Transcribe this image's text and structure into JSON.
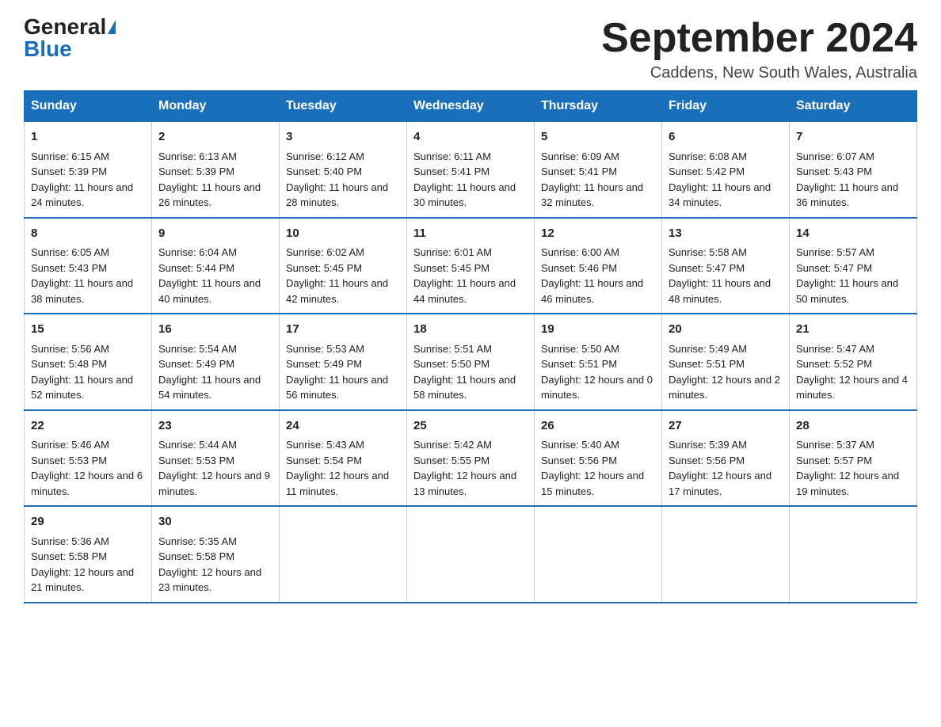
{
  "header": {
    "logo_general": "General",
    "logo_blue": "Blue",
    "month_title": "September 2024",
    "location": "Caddens, New South Wales, Australia"
  },
  "weekdays": [
    "Sunday",
    "Monday",
    "Tuesday",
    "Wednesday",
    "Thursday",
    "Friday",
    "Saturday"
  ],
  "weeks": [
    [
      {
        "day": "1",
        "sunrise": "6:15 AM",
        "sunset": "5:39 PM",
        "daylight": "11 hours and 24 minutes."
      },
      {
        "day": "2",
        "sunrise": "6:13 AM",
        "sunset": "5:39 PM",
        "daylight": "11 hours and 26 minutes."
      },
      {
        "day": "3",
        "sunrise": "6:12 AM",
        "sunset": "5:40 PM",
        "daylight": "11 hours and 28 minutes."
      },
      {
        "day": "4",
        "sunrise": "6:11 AM",
        "sunset": "5:41 PM",
        "daylight": "11 hours and 30 minutes."
      },
      {
        "day": "5",
        "sunrise": "6:09 AM",
        "sunset": "5:41 PM",
        "daylight": "11 hours and 32 minutes."
      },
      {
        "day": "6",
        "sunrise": "6:08 AM",
        "sunset": "5:42 PM",
        "daylight": "11 hours and 34 minutes."
      },
      {
        "day": "7",
        "sunrise": "6:07 AM",
        "sunset": "5:43 PM",
        "daylight": "11 hours and 36 minutes."
      }
    ],
    [
      {
        "day": "8",
        "sunrise": "6:05 AM",
        "sunset": "5:43 PM",
        "daylight": "11 hours and 38 minutes."
      },
      {
        "day": "9",
        "sunrise": "6:04 AM",
        "sunset": "5:44 PM",
        "daylight": "11 hours and 40 minutes."
      },
      {
        "day": "10",
        "sunrise": "6:02 AM",
        "sunset": "5:45 PM",
        "daylight": "11 hours and 42 minutes."
      },
      {
        "day": "11",
        "sunrise": "6:01 AM",
        "sunset": "5:45 PM",
        "daylight": "11 hours and 44 minutes."
      },
      {
        "day": "12",
        "sunrise": "6:00 AM",
        "sunset": "5:46 PM",
        "daylight": "11 hours and 46 minutes."
      },
      {
        "day": "13",
        "sunrise": "5:58 AM",
        "sunset": "5:47 PM",
        "daylight": "11 hours and 48 minutes."
      },
      {
        "day": "14",
        "sunrise": "5:57 AM",
        "sunset": "5:47 PM",
        "daylight": "11 hours and 50 minutes."
      }
    ],
    [
      {
        "day": "15",
        "sunrise": "5:56 AM",
        "sunset": "5:48 PM",
        "daylight": "11 hours and 52 minutes."
      },
      {
        "day": "16",
        "sunrise": "5:54 AM",
        "sunset": "5:49 PM",
        "daylight": "11 hours and 54 minutes."
      },
      {
        "day": "17",
        "sunrise": "5:53 AM",
        "sunset": "5:49 PM",
        "daylight": "11 hours and 56 minutes."
      },
      {
        "day": "18",
        "sunrise": "5:51 AM",
        "sunset": "5:50 PM",
        "daylight": "11 hours and 58 minutes."
      },
      {
        "day": "19",
        "sunrise": "5:50 AM",
        "sunset": "5:51 PM",
        "daylight": "12 hours and 0 minutes."
      },
      {
        "day": "20",
        "sunrise": "5:49 AM",
        "sunset": "5:51 PM",
        "daylight": "12 hours and 2 minutes."
      },
      {
        "day": "21",
        "sunrise": "5:47 AM",
        "sunset": "5:52 PM",
        "daylight": "12 hours and 4 minutes."
      }
    ],
    [
      {
        "day": "22",
        "sunrise": "5:46 AM",
        "sunset": "5:53 PM",
        "daylight": "12 hours and 6 minutes."
      },
      {
        "day": "23",
        "sunrise": "5:44 AM",
        "sunset": "5:53 PM",
        "daylight": "12 hours and 9 minutes."
      },
      {
        "day": "24",
        "sunrise": "5:43 AM",
        "sunset": "5:54 PM",
        "daylight": "12 hours and 11 minutes."
      },
      {
        "day": "25",
        "sunrise": "5:42 AM",
        "sunset": "5:55 PM",
        "daylight": "12 hours and 13 minutes."
      },
      {
        "day": "26",
        "sunrise": "5:40 AM",
        "sunset": "5:56 PM",
        "daylight": "12 hours and 15 minutes."
      },
      {
        "day": "27",
        "sunrise": "5:39 AM",
        "sunset": "5:56 PM",
        "daylight": "12 hours and 17 minutes."
      },
      {
        "day": "28",
        "sunrise": "5:37 AM",
        "sunset": "5:57 PM",
        "daylight": "12 hours and 19 minutes."
      }
    ],
    [
      {
        "day": "29",
        "sunrise": "5:36 AM",
        "sunset": "5:58 PM",
        "daylight": "12 hours and 21 minutes."
      },
      {
        "day": "30",
        "sunrise": "5:35 AM",
        "sunset": "5:58 PM",
        "daylight": "12 hours and 23 minutes."
      },
      null,
      null,
      null,
      null,
      null
    ]
  ],
  "labels": {
    "sunrise": "Sunrise:",
    "sunset": "Sunset:",
    "daylight": "Daylight:"
  }
}
